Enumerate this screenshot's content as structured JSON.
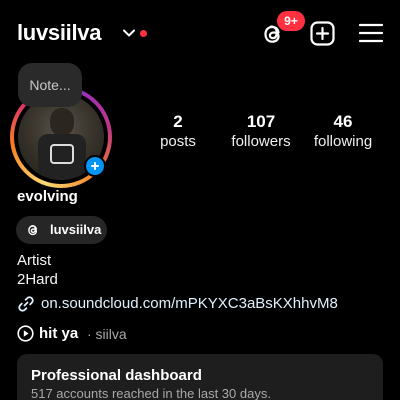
{
  "header": {
    "username": "luvsiilva",
    "notifications_badge": "9+",
    "icons": {
      "threads": "threads-icon",
      "create": "plus-square-icon",
      "menu": "hamburger-menu-icon",
      "switch": "chevron-down-icon"
    },
    "colors": {
      "badge": "#ff3040",
      "accent_blue": "#0095f6"
    }
  },
  "note": {
    "text": "Note..."
  },
  "stats": [
    {
      "value": "2",
      "label": "posts"
    },
    {
      "value": "107",
      "label": "followers"
    },
    {
      "value": "46",
      "label": "following"
    }
  ],
  "profile": {
    "display_name": "evolving",
    "threads_handle": "luvsiilva",
    "bio_line1": "Artist",
    "bio_line2": "2Hard",
    "link": "on.soundcloud.com/mPKYXC3aBsKXhhvM8",
    "music": {
      "title": "hit ya",
      "artist": "· siilva"
    }
  },
  "dashboard": {
    "title": "Professional dashboard",
    "subtitle": "517 accounts reached in the last 30 days."
  }
}
